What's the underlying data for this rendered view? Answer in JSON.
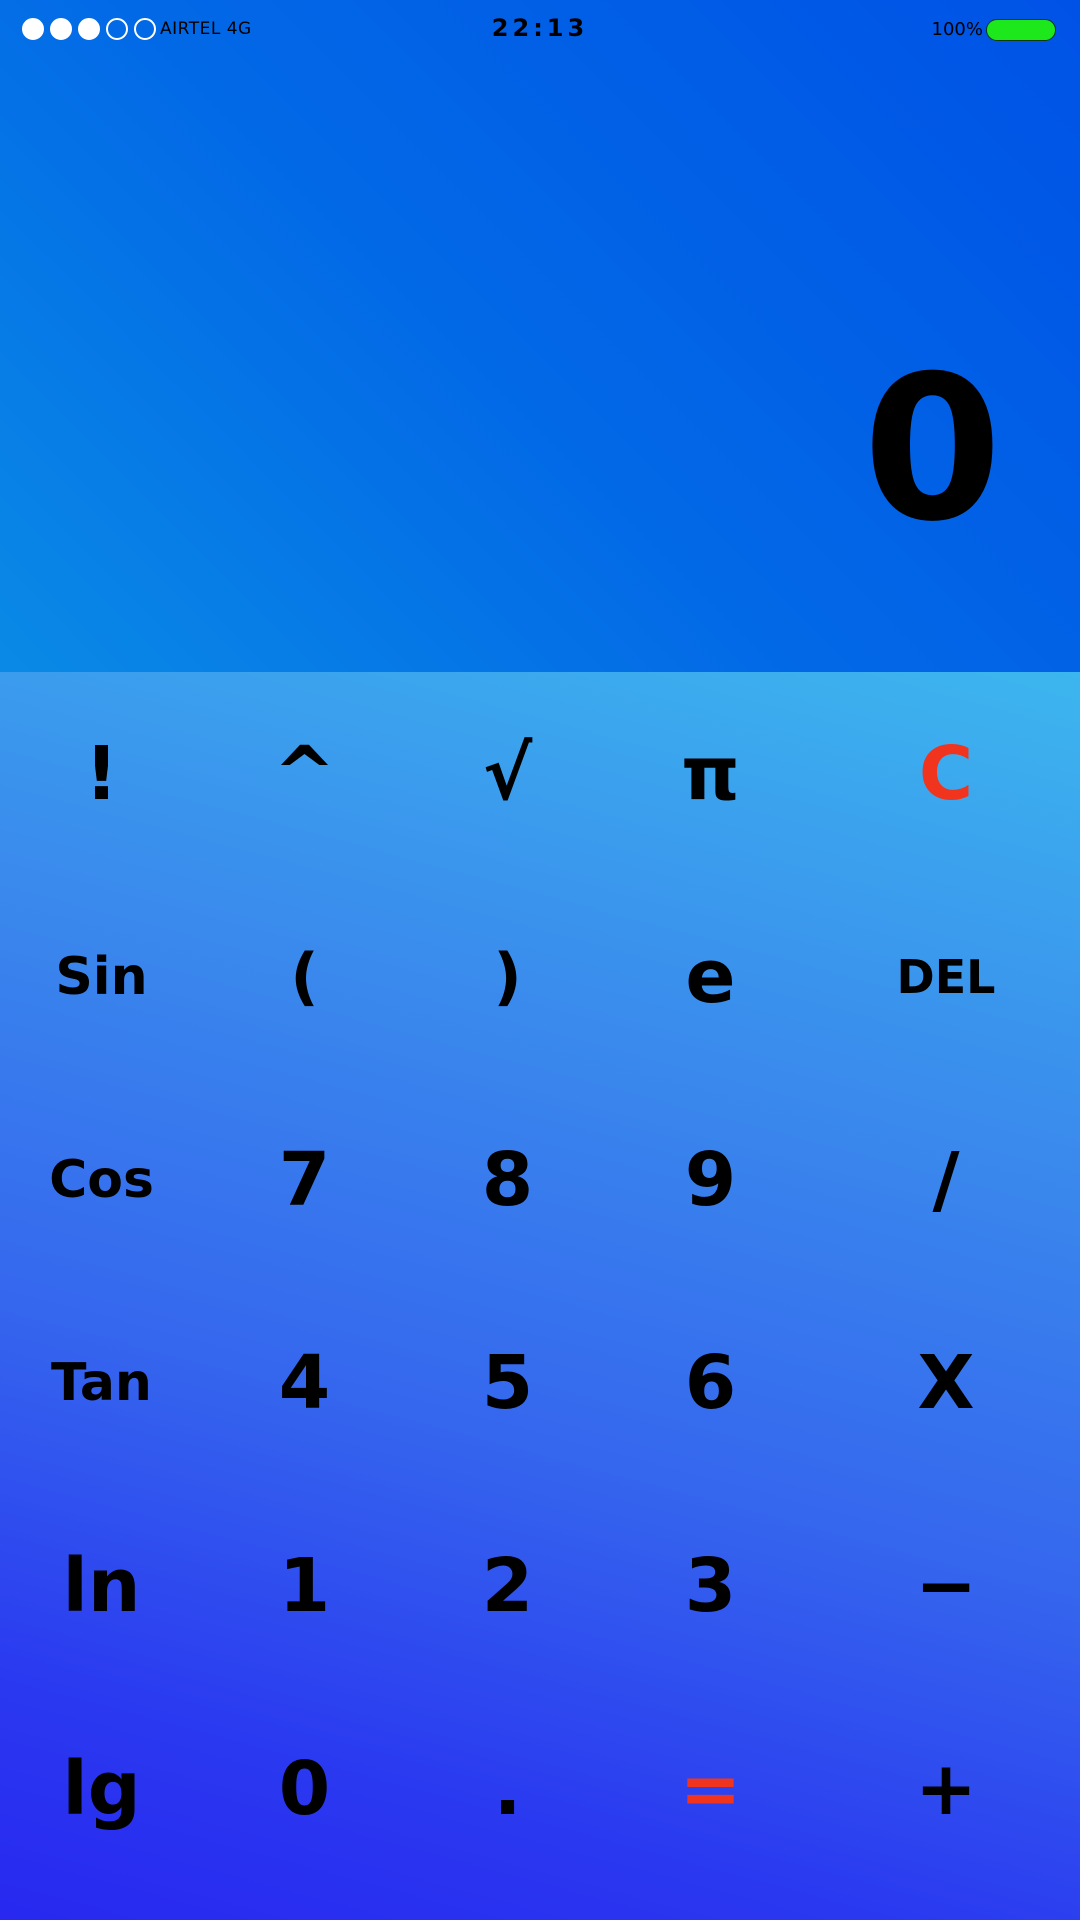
{
  "statusbar": {
    "signal_filled": 3,
    "signal_total": 5,
    "carrier": "AIRTEL 4G",
    "time": "22:13",
    "battery_percent": "100%",
    "battery_level": 1.0
  },
  "display": {
    "value": "0"
  },
  "keys": [
    [
      "!",
      "^",
      "√",
      "π",
      "C"
    ],
    [
      "Sin",
      "(",
      ")",
      "e",
      "DEL"
    ],
    [
      "Cos",
      "7",
      "8",
      "9",
      "/"
    ],
    [
      "Tan",
      "4",
      "5",
      "6",
      "X"
    ],
    [
      "ln",
      "1",
      "2",
      "3",
      "−"
    ],
    [
      "lg",
      "0",
      ".",
      "=",
      "+"
    ]
  ],
  "colors": {
    "accent_red": "#f0341e",
    "battery_green": "#1ce81c",
    "display_blue": "#0269e6",
    "keypad_blue": "#3566ee"
  }
}
